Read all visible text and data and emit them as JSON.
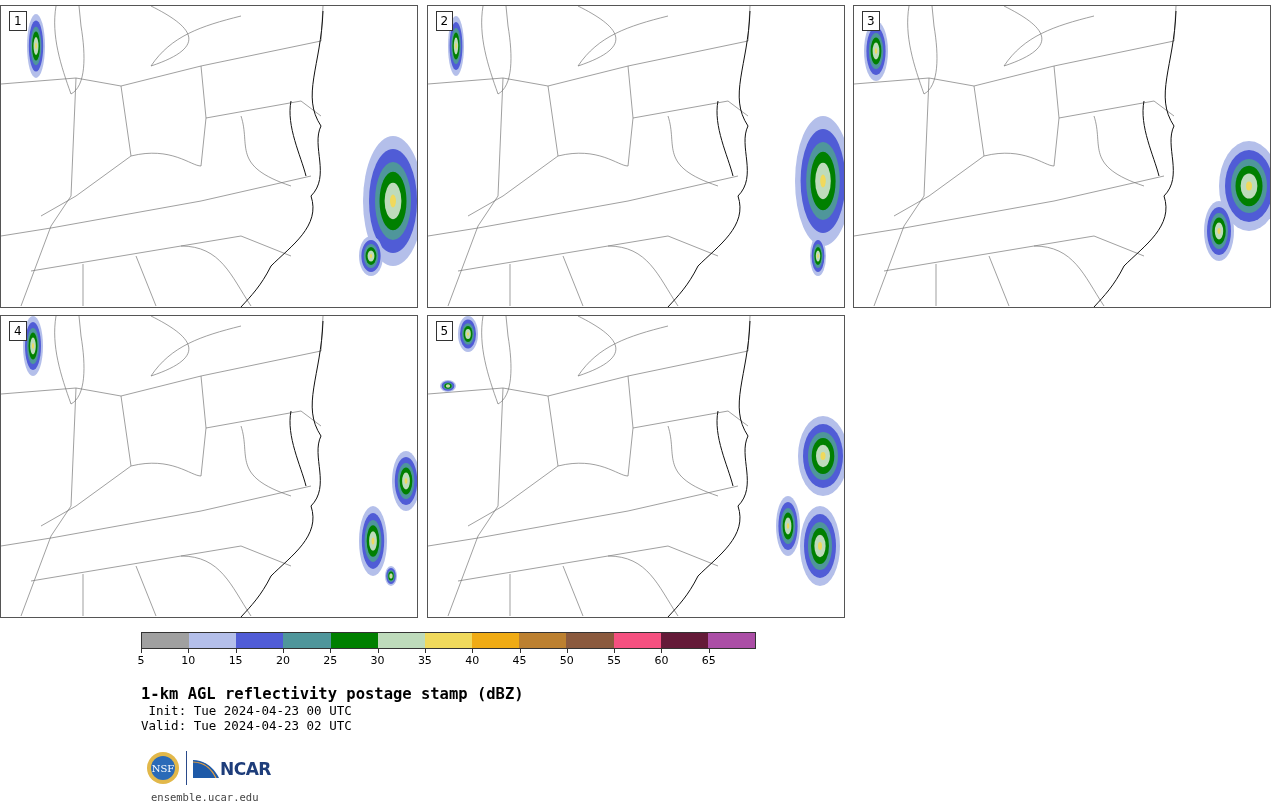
{
  "panels": [
    {
      "label": "1"
    },
    {
      "label": "2"
    },
    {
      "label": "3"
    },
    {
      "label": "4"
    },
    {
      "label": "5"
    }
  ],
  "colorbar": {
    "bins": [
      {
        "color": "#a0a0a0",
        "tick": "5"
      },
      {
        "color": "#b4bfea",
        "tick": "10"
      },
      {
        "color": "#505cd6",
        "tick": "15"
      },
      {
        "color": "#4f969b",
        "tick": "20"
      },
      {
        "color": "#008000",
        "tick": "25"
      },
      {
        "color": "#bedbbb",
        "tick": "30"
      },
      {
        "color": "#f0d95c",
        "tick": "35"
      },
      {
        "color": "#f0ab14",
        "tick": "40"
      },
      {
        "color": "#bc8030",
        "tick": "45"
      },
      {
        "color": "#8b5a3e",
        "tick": "50"
      },
      {
        "color": "#f55080",
        "tick": "55"
      },
      {
        "color": "#641a38",
        "tick": "60"
      },
      {
        "color": "#ab4ea6",
        "tick": "65"
      }
    ]
  },
  "title": "1-km AGL reflectivity postage stamp (dBZ)",
  "init": " Init: Tue 2024-04-23 00 UTC",
  "valid": "Valid: Tue 2024-04-23 02 UTC",
  "logos": {
    "nsf": "NSF",
    "ncar": "NCAR"
  },
  "url": "ensemble.ucar.edu"
}
